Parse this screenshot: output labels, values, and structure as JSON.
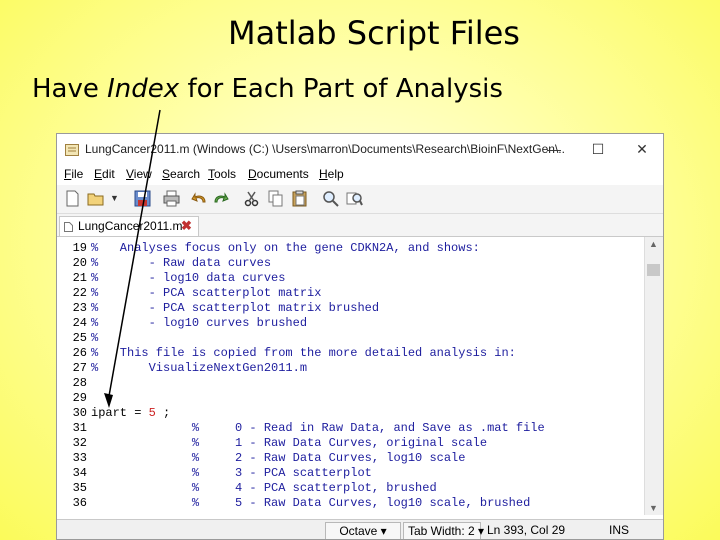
{
  "slide": {
    "title": "Matlab Script Files",
    "subtitle_pre": "Have ",
    "subtitle_italic": "Index",
    "subtitle_post": " for Each Part of Analysis"
  },
  "window": {
    "title": "LungCancer2011.m (Windows (C:) \\Users\\marron\\Documents\\Research\\BioinF\\NextGen\\...",
    "minimize": "—",
    "maximize": "☐",
    "close": "✕"
  },
  "menu": [
    "File",
    "Edit",
    "View",
    "Search",
    "Tools",
    "Documents",
    "Help"
  ],
  "tab": {
    "label": "LungCancer2011.m",
    "close": "✖"
  },
  "lines": [
    {
      "n": "19",
      "parts": [
        {
          "t": "%   Analyses focus only on the gene CDKN2A, and shows:",
          "c": "comment"
        }
      ]
    },
    {
      "n": "20",
      "parts": [
        {
          "t": "%       - Raw data curves",
          "c": "comment"
        }
      ]
    },
    {
      "n": "21",
      "parts": [
        {
          "t": "%       - log10 data curves",
          "c": "comment"
        }
      ]
    },
    {
      "n": "22",
      "parts": [
        {
          "t": "%       - PCA scatterplot matrix",
          "c": "comment"
        }
      ]
    },
    {
      "n": "23",
      "parts": [
        {
          "t": "%       - PCA scatterplot matrix brushed",
          "c": "comment"
        }
      ]
    },
    {
      "n": "24",
      "parts": [
        {
          "t": "%       - log10 curves brushed",
          "c": "comment"
        }
      ]
    },
    {
      "n": "25",
      "parts": [
        {
          "t": "%",
          "c": "comment"
        }
      ]
    },
    {
      "n": "26",
      "parts": [
        {
          "t": "%   This file is copied from the more detailed analysis in:",
          "c": "comment"
        }
      ]
    },
    {
      "n": "27",
      "parts": [
        {
          "t": "%       VisualizeNextGen2011.m",
          "c": "comment"
        }
      ]
    },
    {
      "n": "28",
      "parts": []
    },
    {
      "n": "29",
      "parts": []
    },
    {
      "n": "30",
      "parts": [
        {
          "t": "ipart = ",
          "c": "plain"
        },
        {
          "t": "5",
          "c": "num"
        },
        {
          "t": " ;",
          "c": "plain"
        }
      ]
    },
    {
      "n": "31",
      "parts": [
        {
          "t": "              %     0 - Read in Raw Data, and Save as .mat file",
          "c": "comment"
        }
      ]
    },
    {
      "n": "32",
      "parts": [
        {
          "t": "              %     1 - Raw Data Curves, original scale",
          "c": "comment"
        }
      ]
    },
    {
      "n": "33",
      "parts": [
        {
          "t": "              %     2 - Raw Data Curves, log10 scale",
          "c": "comment"
        }
      ]
    },
    {
      "n": "34",
      "parts": [
        {
          "t": "              %     3 - PCA scatterplot",
          "c": "comment"
        }
      ]
    },
    {
      "n": "35",
      "parts": [
        {
          "t": "              %     4 - PCA scatterplot, brushed",
          "c": "comment"
        }
      ]
    },
    {
      "n": "36",
      "parts": [
        {
          "t": "              %     5 - Raw Data Curves, log10 scale, brushed",
          "c": "comment"
        }
      ]
    }
  ],
  "status": {
    "language": "Octave ▾",
    "tab_width": "Tab Width:  2  ▾",
    "position": "Ln 393, Col 29",
    "mode": "INS"
  },
  "icons": [
    "new-file-icon",
    "open-folder-icon",
    "save-icon",
    "print-icon",
    "undo-icon",
    "redo-icon",
    "cut-icon",
    "copy-icon",
    "paste-icon",
    "find-icon",
    "replace-icon"
  ],
  "colors": {
    "comment": "#1d1d9e",
    "number": "#cc2222",
    "background_yellow": "#fbfb5a"
  }
}
